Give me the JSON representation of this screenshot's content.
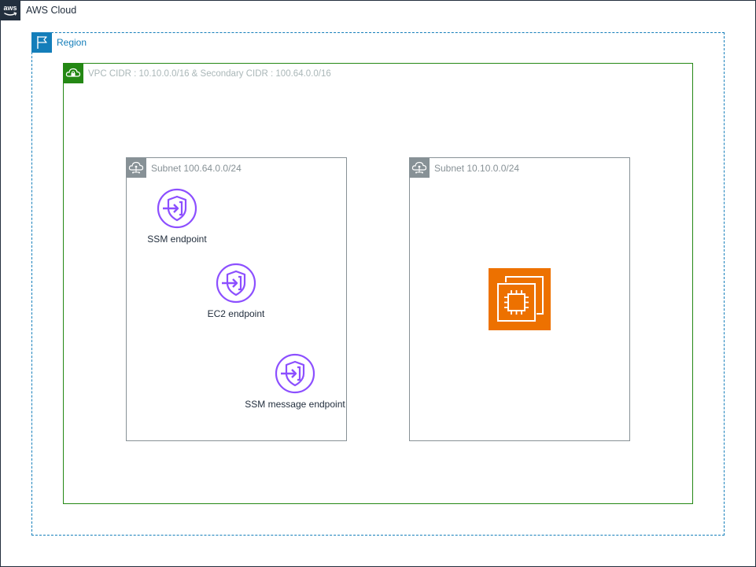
{
  "aws_cloud": {
    "label": "AWS Cloud",
    "icon": "aws-logo-icon",
    "color": "#232f3e"
  },
  "region": {
    "label": "Region",
    "icon": "region-flag-icon",
    "color": "#147eba"
  },
  "vpc": {
    "label": "VPC CIDR : 10.10.0.0/16 & Secondary CIDR : 100.64.0.0/16",
    "icon": "vpc-lock-cloud-icon",
    "color": "#248814"
  },
  "subnets": [
    {
      "label": "Subnet 100.64.0.0/24",
      "icon": "subnet-cloud-icon",
      "endpoints": [
        {
          "label": "SSM endpoint",
          "icon": "vpc-endpoint-icon"
        },
        {
          "label": "EC2 endpoint",
          "icon": "vpc-endpoint-icon"
        },
        {
          "label": "SSM message endpoint",
          "icon": "vpc-endpoint-icon"
        }
      ]
    },
    {
      "label": "Subnet 10.10.0.0/24",
      "icon": "subnet-cloud-icon",
      "instance": {
        "icon": "ec2-instance-icon",
        "color": "#ed7100"
      }
    }
  ],
  "colors": {
    "endpoint": "#8c4fff",
    "subnet": "#879196"
  }
}
